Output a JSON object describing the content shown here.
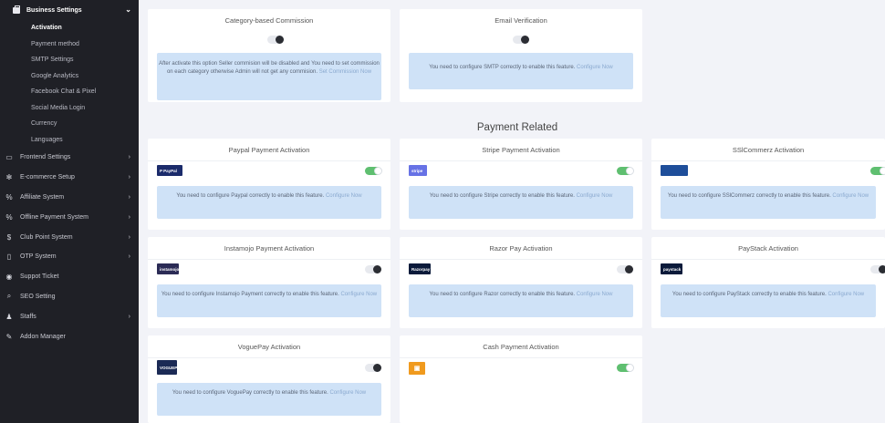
{
  "sidebar": {
    "header": "Business Settings",
    "subitems": [
      {
        "label": "Activation",
        "active": true
      },
      {
        "label": "Payment method"
      },
      {
        "label": "SMTP Settings"
      },
      {
        "label": "Google Analytics"
      },
      {
        "label": "Facebook Chat & Pixel"
      },
      {
        "label": "Social Media Login"
      },
      {
        "label": "Currency"
      },
      {
        "label": "Languages"
      }
    ],
    "menu": [
      {
        "label": "Frontend Settings",
        "icon": "monitor-icon"
      },
      {
        "label": "E-commerce Setup",
        "icon": "gear-icon"
      },
      {
        "label": "Affiliate System",
        "icon": "percent-icon"
      },
      {
        "label": "Offline Payment System",
        "icon": "percent-icon"
      },
      {
        "label": "Club Point System",
        "icon": "dollar-icon"
      },
      {
        "label": "OTP System",
        "icon": "phone-icon"
      },
      {
        "label": "Suppot Ticket",
        "icon": "support-icon"
      },
      {
        "label": "SEO Setting",
        "icon": "search-icon"
      },
      {
        "label": "Staffs",
        "icon": "user-icon"
      },
      {
        "label": "Addon Manager",
        "icon": "wrench-icon"
      }
    ]
  },
  "top_cards": {
    "commission": {
      "title": "Category-based Commission",
      "text": "After activate this option Seller commision will be disabled and You need to set commission on each category otherwise Admin will not get any commision.",
      "link": "Set Commission Now",
      "enabled": false
    },
    "email": {
      "title": "Email Verification",
      "text": "You need to configure SMTP correctly to enable this feature.",
      "link": "Configure Now",
      "enabled": false
    }
  },
  "section_title": "Payment Related",
  "payments": [
    {
      "title": "Paypal Payment Activation",
      "logo": "P PayPal",
      "logo_color": "#1b2b6b",
      "text": "You need to configure Paypal correctly to enable this feature.",
      "link": "Configure Now",
      "enabled": true
    },
    {
      "title": "Stripe Payment Activation",
      "logo": "stripe",
      "logo_color": "#6772e5",
      "text": "You need to configure Stripe correctly to enable this feature.",
      "link": "Configure Now",
      "enabled": true
    },
    {
      "title": "SSlCommerz Activation",
      "logo": "",
      "logo_color": "#1e4e9a",
      "text": "You need to configure SSlCommerz correctly to enable this feature.",
      "link": "Configure Now",
      "enabled": true
    },
    {
      "title": "Instamojo Payment Activation",
      "logo": "instamojo",
      "logo_color": "#2b2b55",
      "text": "You need to configure Instamojo Payment correctly to enable this feature.",
      "link": "Configure Now",
      "enabled": false
    },
    {
      "title": "Razor Pay Activation",
      "logo": "Razorpay",
      "logo_color": "#0b1a3a",
      "text": "You need to configure Razor correctly to enable this feature.",
      "link": "Configure Now",
      "enabled": false
    },
    {
      "title": "PayStack Activation",
      "logo": "paystack",
      "logo_color": "#0b1a3a",
      "text": "You need to configure PayStack correctly to enable this feature.",
      "link": "Configure Now",
      "enabled": false
    },
    {
      "title": "VoguePay Activation",
      "logo": "VOGUEPAY",
      "logo_color": "#1b2a55",
      "text": "You need to configure VoguePay correctly to enable this feature.",
      "link": "Configure Now",
      "enabled": false
    },
    {
      "title": "Cash Payment Activation",
      "logo": "",
      "logo_color": "#f09a1e",
      "text": "",
      "link": "",
      "enabled": true
    }
  ]
}
